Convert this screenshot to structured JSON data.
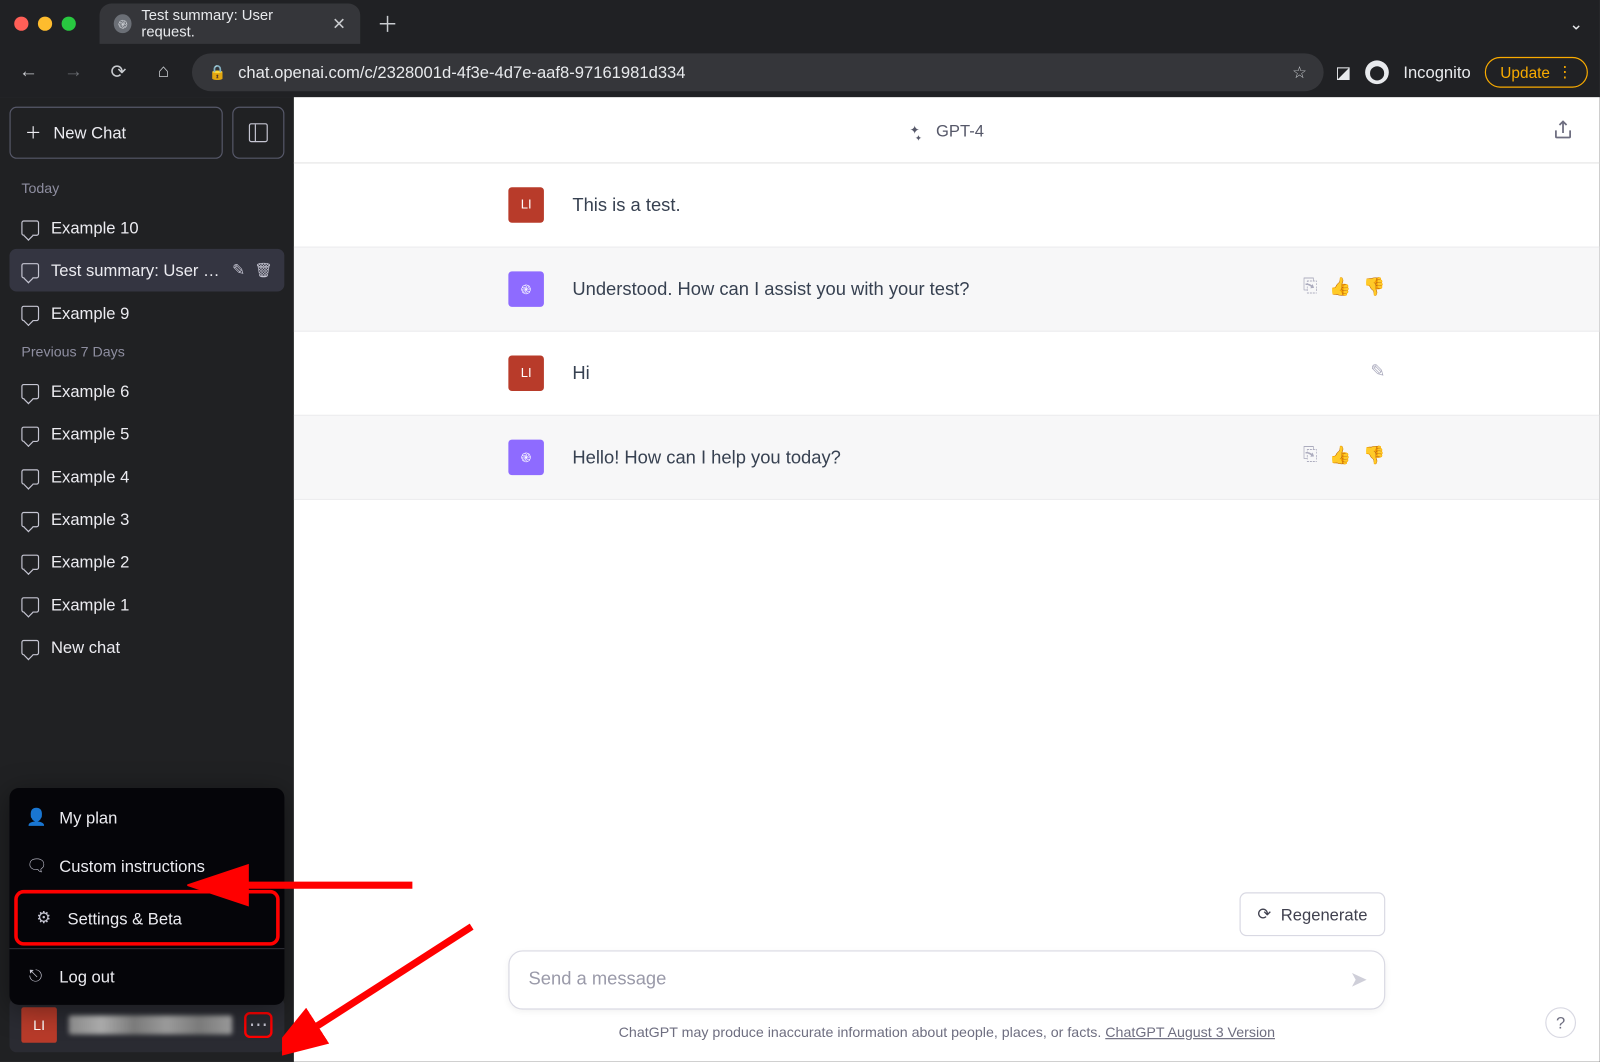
{
  "browser": {
    "tab_title": "Test summary: User request.",
    "url": "chat.openai.com/c/2328001d-4f3e-4d7e-aaf8-97161981d334",
    "incognito_label": "Incognito",
    "update_label": "Update"
  },
  "sidebar": {
    "new_chat_label": "New Chat",
    "sections": {
      "today": "Today",
      "prev7": "Previous 7 Days"
    },
    "chats_today": [
      {
        "title": "Example 10"
      },
      {
        "title": "Test summary: User req",
        "active": true
      },
      {
        "title": "Example 9"
      }
    ],
    "chats_prev7": [
      {
        "title": "Example 6"
      },
      {
        "title": "Example 5"
      },
      {
        "title": "Example 4"
      },
      {
        "title": "Example 3"
      },
      {
        "title": "Example 2"
      },
      {
        "title": "Example 1"
      },
      {
        "title": "New chat"
      }
    ],
    "menu": {
      "my_plan": "My plan",
      "custom_instructions": "Custom instructions",
      "settings_beta": "Settings & Beta",
      "log_out": "Log out"
    },
    "avatar_initials": "LI"
  },
  "header": {
    "model": "GPT-4"
  },
  "conversation": [
    {
      "role": "user",
      "avatar": "LI",
      "text": "This is a test."
    },
    {
      "role": "assistant",
      "text": "Understood. How can I assist you with your test?"
    },
    {
      "role": "user",
      "avatar": "LI",
      "text": "Hi"
    },
    {
      "role": "assistant",
      "text": "Hello! How can I help you today?"
    }
  ],
  "composer": {
    "regenerate": "Regenerate",
    "placeholder": "Send a message",
    "disclaimer_prefix": "ChatGPT may produce inaccurate information about people, places, or facts. ",
    "disclaimer_link": "ChatGPT August 3 Version"
  }
}
